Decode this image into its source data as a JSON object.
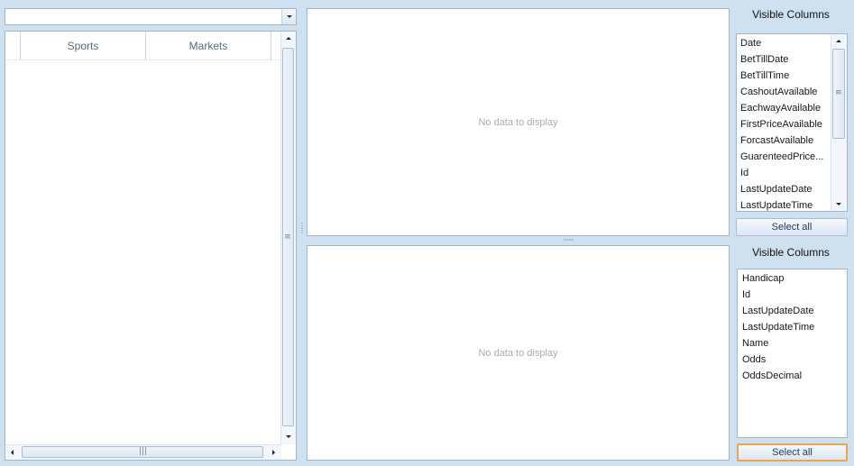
{
  "navigator": {
    "combo_value": "",
    "tree_columns": [
      "Sports",
      "Markets"
    ]
  },
  "top_grid": {
    "empty_text": "No data to display"
  },
  "bottom_grid": {
    "empty_text": "No data to display"
  },
  "top_columns_panel": {
    "title": "Visible Columns",
    "items": [
      "Date",
      "BetTillDate",
      "BetTillTime",
      "CashoutAvailable",
      "EachwayAvailable",
      "FirstPriceAvailable",
      "ForcastAvailable",
      "GuarenteedPrice...",
      "Id",
      "LastUpdateDate",
      "LastUpdateTime"
    ],
    "select_all_label": "Select all"
  },
  "bottom_columns_panel": {
    "title": "Visible Columns",
    "items": [
      "Handicap",
      "Id",
      "LastUpdateDate",
      "LastUpdateTime",
      "Name",
      "Odds",
      "OddsDecimal"
    ],
    "select_all_label": "Select all"
  }
}
